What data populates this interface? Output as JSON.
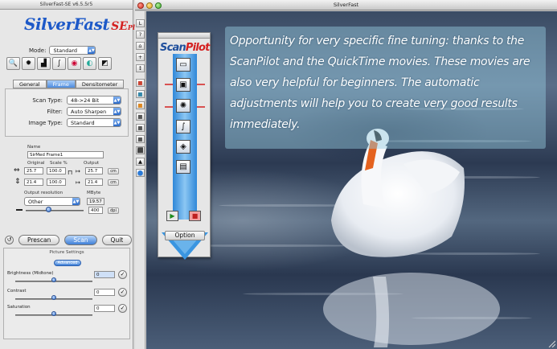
{
  "panel": {
    "title": "SilverFast-SE v6.5.5r5",
    "logo": {
      "part1": "SilverFast",
      "part2": "SE",
      "part3": "Plus"
    },
    "mode_label": "Mode:",
    "mode_value": "Standard",
    "tabs": [
      "General",
      "Frame",
      "Densitometer"
    ],
    "active_tab": "Frame",
    "scan_type_label": "Scan Type:",
    "scan_type_value": "48->24 Bit",
    "filter_label": "Filter:",
    "filter_value": "Auto Sharpen",
    "image_type_label": "Image Type:",
    "image_type_value": "Standard",
    "name_label": "Name",
    "name_value": "SirMed Frame1",
    "original_label": "Original",
    "scale_label": "Scale %",
    "output_label": "Output",
    "w_orig": "25.7",
    "h_orig": "21.4",
    "scale1": "100.0",
    "scale2": "100.0",
    "w_out": "25.7",
    "h_out": "21.4",
    "unit": "cm",
    "output_res_label": "Output resolution",
    "output_res_value": "Other",
    "mbyte_label": "MByte",
    "mbyte_value": "19.57",
    "res_value": "400",
    "res_unit": "dpi",
    "prescan": "Prescan",
    "scan": "Scan",
    "quit": "Quit",
    "picture_settings": "Picture Settings",
    "advanced": "Advanced",
    "brightness_label": "Brightness (Midtone)",
    "brightness_value": "0",
    "contrast_label": "Contrast",
    "contrast_value": "0",
    "saturation_label": "Saturation",
    "saturation_value": "0"
  },
  "main": {
    "title": "SilverFast",
    "overlay_text": "Opportunity for very specific fine tuning: thanks to the ScanPilot and the QuickTime movies. These movies are also very helpful for beginners. The automatic adjustments will help you to create very good results immediately.",
    "toolstrip_glyphs": [
      "L",
      "?",
      "⌂",
      "+",
      "↕",
      "■",
      "■",
      "■",
      "■",
      "■",
      "■",
      "⬛",
      "▲",
      "⬤"
    ]
  },
  "scanpilot": {
    "logo_scan": "Scan",
    "logo_pilot": "Pilot",
    "option": "Option"
  }
}
